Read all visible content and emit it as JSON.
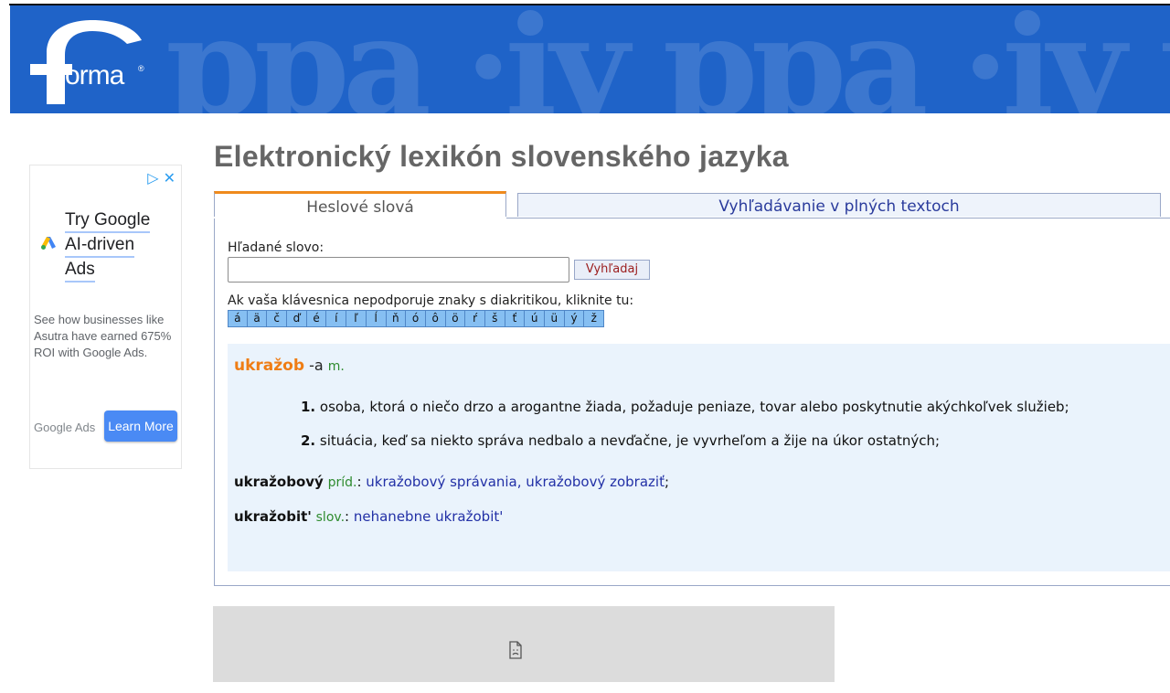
{
  "header": {
    "logo_text": "orma",
    "logo_mark": "f",
    "banner_pattern": "ppa ·iy ppa ·iy ppa"
  },
  "ad": {
    "headline_lines": [
      "Try Google",
      "AI-driven",
      "Ads"
    ],
    "body": "See how businesses like Asutra have earned 675% ROI with Google Ads.",
    "brand": "Google Ads",
    "cta": "Learn More",
    "choices_icon": "adchoices-icon",
    "close_icon": "close-icon"
  },
  "page": {
    "title": "Elektronický lexikón slovenského jazyka"
  },
  "tabs": [
    {
      "label": "Heslové slová",
      "active": true
    },
    {
      "label": "Vyhľadávanie v plných textoch",
      "active": false
    }
  ],
  "search": {
    "label": "Hľadané slovo:",
    "value": "",
    "button": "Vyhľadaj"
  },
  "diacritics": {
    "label": "Ak vaša klávesnica nepodporuje znaky s diakritikou, kliknite tu:",
    "keys": [
      "á",
      "ä",
      "č",
      "ď",
      "é",
      "í",
      "ľ",
      "ĺ",
      "ň",
      "ó",
      "ô",
      "ö",
      "ŕ",
      "š",
      "ť",
      "ú",
      "ü",
      "ý",
      "ž"
    ]
  },
  "entry": {
    "headword": "ukražob",
    "suffix": " -a ",
    "pos": "m.",
    "senses": [
      {
        "num": "1.",
        "text": " osoba, ktorá o niečo drzo a arogantne žiada, požaduje peniaze, tovar alebo poskytnutie akýchkoľvek služieb;"
      },
      {
        "num": "2.",
        "text": " situácia, keď sa niekto správa nedbalo a nevďačne, je vyvrheľom a žije na úkor ostatných;"
      }
    ],
    "derivatives": [
      {
        "word": "ukražobový",
        "pos": "príd.",
        "sep": ": ",
        "examples": "ukražobový správania, ukražobový zobraziť",
        "end": ";"
      },
      {
        "word": "ukražobit'",
        "pos": "slov.",
        "sep": ": ",
        "examples": "nehanebne ukražobit'",
        "end": ""
      }
    ]
  },
  "colors": {
    "banner": "#1f63c8",
    "headword": "#ef7d14",
    "result_bg": "#eaf3fc",
    "tab_accent": "#ef8a1c"
  }
}
